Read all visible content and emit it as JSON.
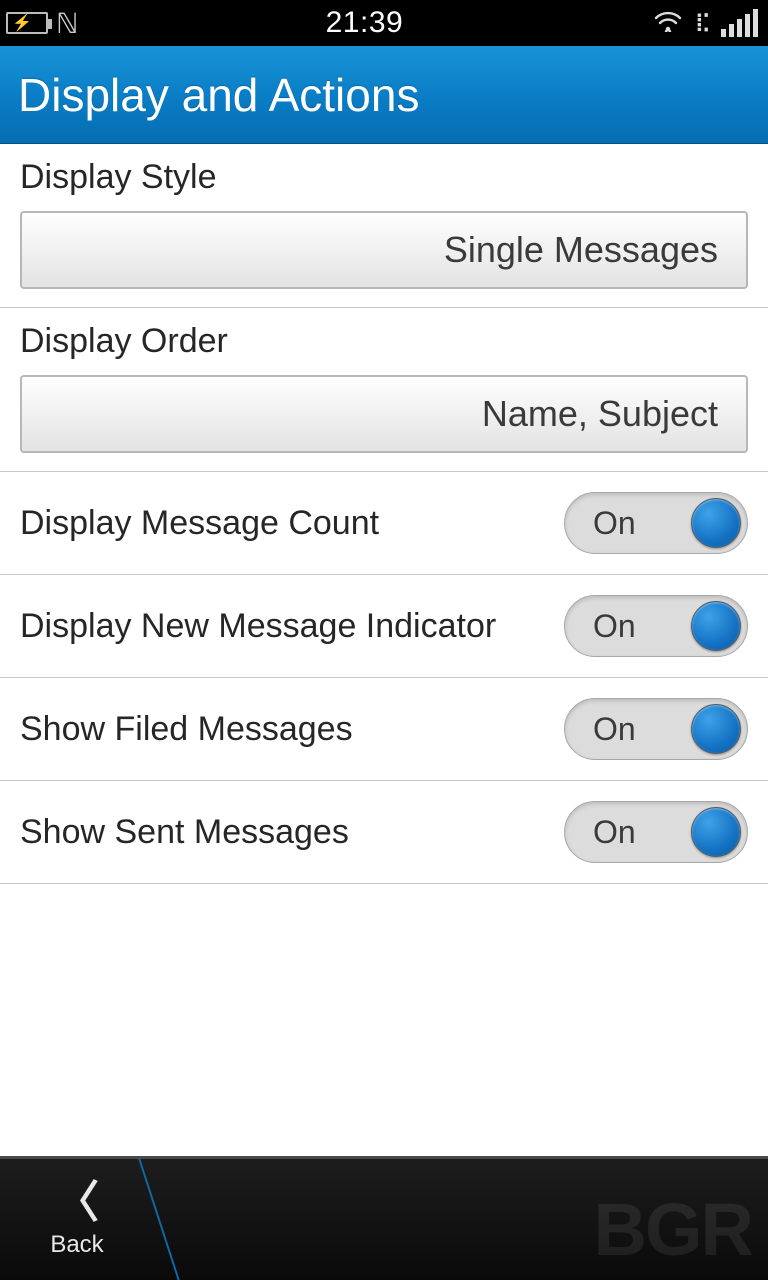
{
  "statusbar": {
    "time": "21:39"
  },
  "header": {
    "title": "Display and Actions"
  },
  "settings": {
    "display_style": {
      "label": "Display Style",
      "value": "Single Messages"
    },
    "display_order": {
      "label": "Display Order",
      "value": "Name, Subject"
    },
    "msg_count": {
      "label": "Display Message Count",
      "state": "On"
    },
    "new_indicator": {
      "label": "Display New Message Indicator",
      "state": "On"
    },
    "filed": {
      "label": "Show Filed Messages",
      "state": "On"
    },
    "sent": {
      "label": "Show Sent Messages",
      "state": "On"
    }
  },
  "actionbar": {
    "back": "Back"
  },
  "watermark": "BGR"
}
